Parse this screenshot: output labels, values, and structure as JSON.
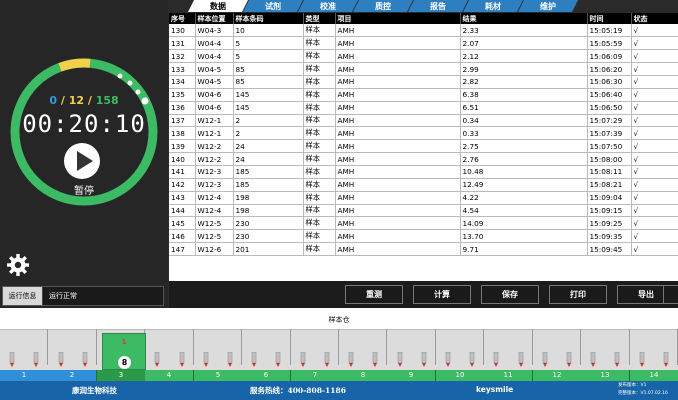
{
  "tabs": [
    {
      "label": "数据",
      "active": true
    },
    {
      "label": "试剂",
      "active": false
    },
    {
      "label": "校准",
      "active": false
    },
    {
      "label": "质控",
      "active": false
    },
    {
      "label": "报告",
      "active": false
    },
    {
      "label": "耗材",
      "active": false
    },
    {
      "label": "维护",
      "active": false
    }
  ],
  "table": {
    "headers": [
      "序号",
      "样本位置",
      "样本条码",
      "类型",
      "项目",
      "结果",
      "时间",
      "状态"
    ],
    "rows": [
      [
        "130",
        "W04-3",
        "10",
        "样本",
        "AMH",
        "2.33",
        "15:05:19",
        "√"
      ],
      [
        "131",
        "W04-4",
        "5",
        "样本",
        "AMH",
        "2.07",
        "15:05:59",
        "√"
      ],
      [
        "132",
        "W04-4",
        "5",
        "样本",
        "AMH",
        "2.12",
        "15:06:09",
        "√"
      ],
      [
        "133",
        "W04-5",
        "85",
        "样本",
        "AMH",
        "2.99",
        "15:06:20",
        "√"
      ],
      [
        "134",
        "W04-5",
        "85",
        "样本",
        "AMH",
        "2.82",
        "15:06:30",
        "√"
      ],
      [
        "135",
        "W04-6",
        "145",
        "样本",
        "AMH",
        "6.38",
        "15:06:40",
        "√"
      ],
      [
        "136",
        "W04-6",
        "145",
        "样本",
        "AMH",
        "6.51",
        "15:06:50",
        "√"
      ],
      [
        "137",
        "W12-1",
        "2",
        "样本",
        "AMH",
        "0.34",
        "15:07:29",
        "√"
      ],
      [
        "138",
        "W12-1",
        "2",
        "样本",
        "AMH",
        "0.33",
        "15:07:39",
        "√"
      ],
      [
        "139",
        "W12-2",
        "24",
        "样本",
        "AMH",
        "2.75",
        "15:07:50",
        "√"
      ],
      [
        "140",
        "W12-2",
        "24",
        "样本",
        "AMH",
        "2.76",
        "15:08:00",
        "√"
      ],
      [
        "141",
        "W12-3",
        "185",
        "样本",
        "AMH",
        "10.48",
        "15:08:11",
        "√"
      ],
      [
        "142",
        "W12-3",
        "185",
        "样本",
        "AMH",
        "12.49",
        "15:08:21",
        "√"
      ],
      [
        "143",
        "W12-4",
        "198",
        "样本",
        "AMH",
        "4.22",
        "15:09:04",
        "√"
      ],
      [
        "144",
        "W12-4",
        "198",
        "样本",
        "AMH",
        "4.54",
        "15:09:15",
        "√"
      ],
      [
        "145",
        "W12-5",
        "230",
        "样本",
        "AMH",
        "14.09",
        "15:09:25",
        "√"
      ],
      [
        "146",
        "W12-5",
        "230",
        "样本",
        "AMH",
        "13.70",
        "15:09:35",
        "√"
      ],
      [
        "147",
        "W12-6",
        "201",
        "样本",
        "AMH",
        "9.71",
        "15:09:45",
        "√"
      ]
    ]
  },
  "counter": {
    "done": "0",
    "running": "12",
    "total": "158",
    "separator": "/"
  },
  "timer": "00:20:10",
  "progress": {
    "done_fraction": 0.0,
    "running_fraction": 0.076
  },
  "pause_label": "暂停",
  "status": {
    "label": "运行信息",
    "value": "运行正常"
  },
  "actions": [
    "重测",
    "计算",
    "保存",
    "打印",
    "导出"
  ],
  "rack": {
    "title": "样本仓",
    "slots": [
      "1",
      "2",
      "3",
      "4",
      "5",
      "6",
      "7",
      "8",
      "9",
      "10",
      "11",
      "12",
      "13",
      "14"
    ],
    "active_slot": "3",
    "tray_mark": "1",
    "tray_number": "8"
  },
  "footer": {
    "company": "康润生物科技",
    "hotline": "服务热线：400-808-1186",
    "brand": "keysmile",
    "version1": "发布版本：V1",
    "version2": "完整版本：V1.07.02.16"
  },
  "colors": {
    "ring_green": "#3dba64",
    "ring_yellow": "#f2d04a",
    "tab_blue": "#2e7fc0",
    "footer_blue": "#1764a8",
    "slot_blue": "#2f8fd8"
  },
  "icons": {
    "settings": "gear-icon",
    "play": "play-icon"
  }
}
